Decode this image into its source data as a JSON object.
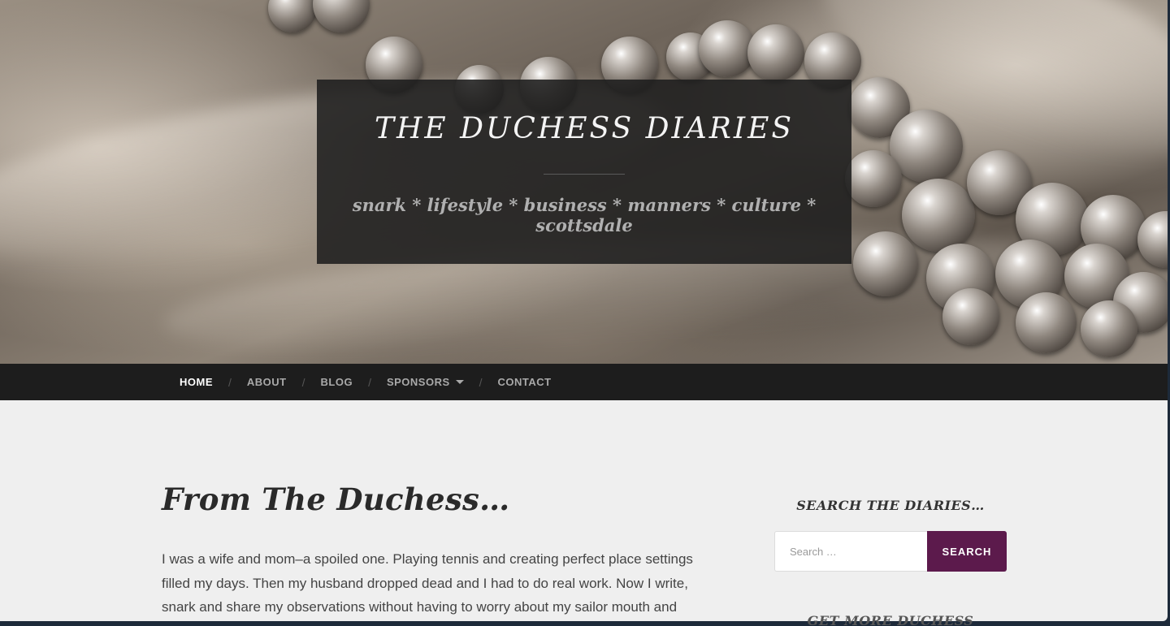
{
  "site": {
    "title": "THE DUCHESS DIARIES",
    "tagline": "snark * lifestyle * business * manners * culture * scottsdale"
  },
  "nav": {
    "items": [
      {
        "label": "HOME",
        "current": true
      },
      {
        "label": "ABOUT"
      },
      {
        "label": "BLOG"
      },
      {
        "label": "SPONSORS",
        "has_dropdown": true
      },
      {
        "label": "CONTACT"
      }
    ],
    "separator": "/"
  },
  "main": {
    "post_title": "From The Duchess…",
    "post_lines": [
      "I was a wife and mom–a spoiled one. Playing tennis and creating perfect place settings",
      "filled my days. Then my husband dropped dead and I had to do real work. Now I write,",
      "snark and share my observations without having to worry about my sailor mouth and"
    ]
  },
  "sidebar": {
    "search_title": "SEARCH THE DIARIES…",
    "search_placeholder": "Search …",
    "search_button": "SEARCH",
    "next_widget_title": "GET MORE DUCHESS"
  },
  "colors": {
    "accent": "#5c1a4c",
    "nav_bg": "#1d1d1d",
    "content_bg": "#efefef"
  }
}
